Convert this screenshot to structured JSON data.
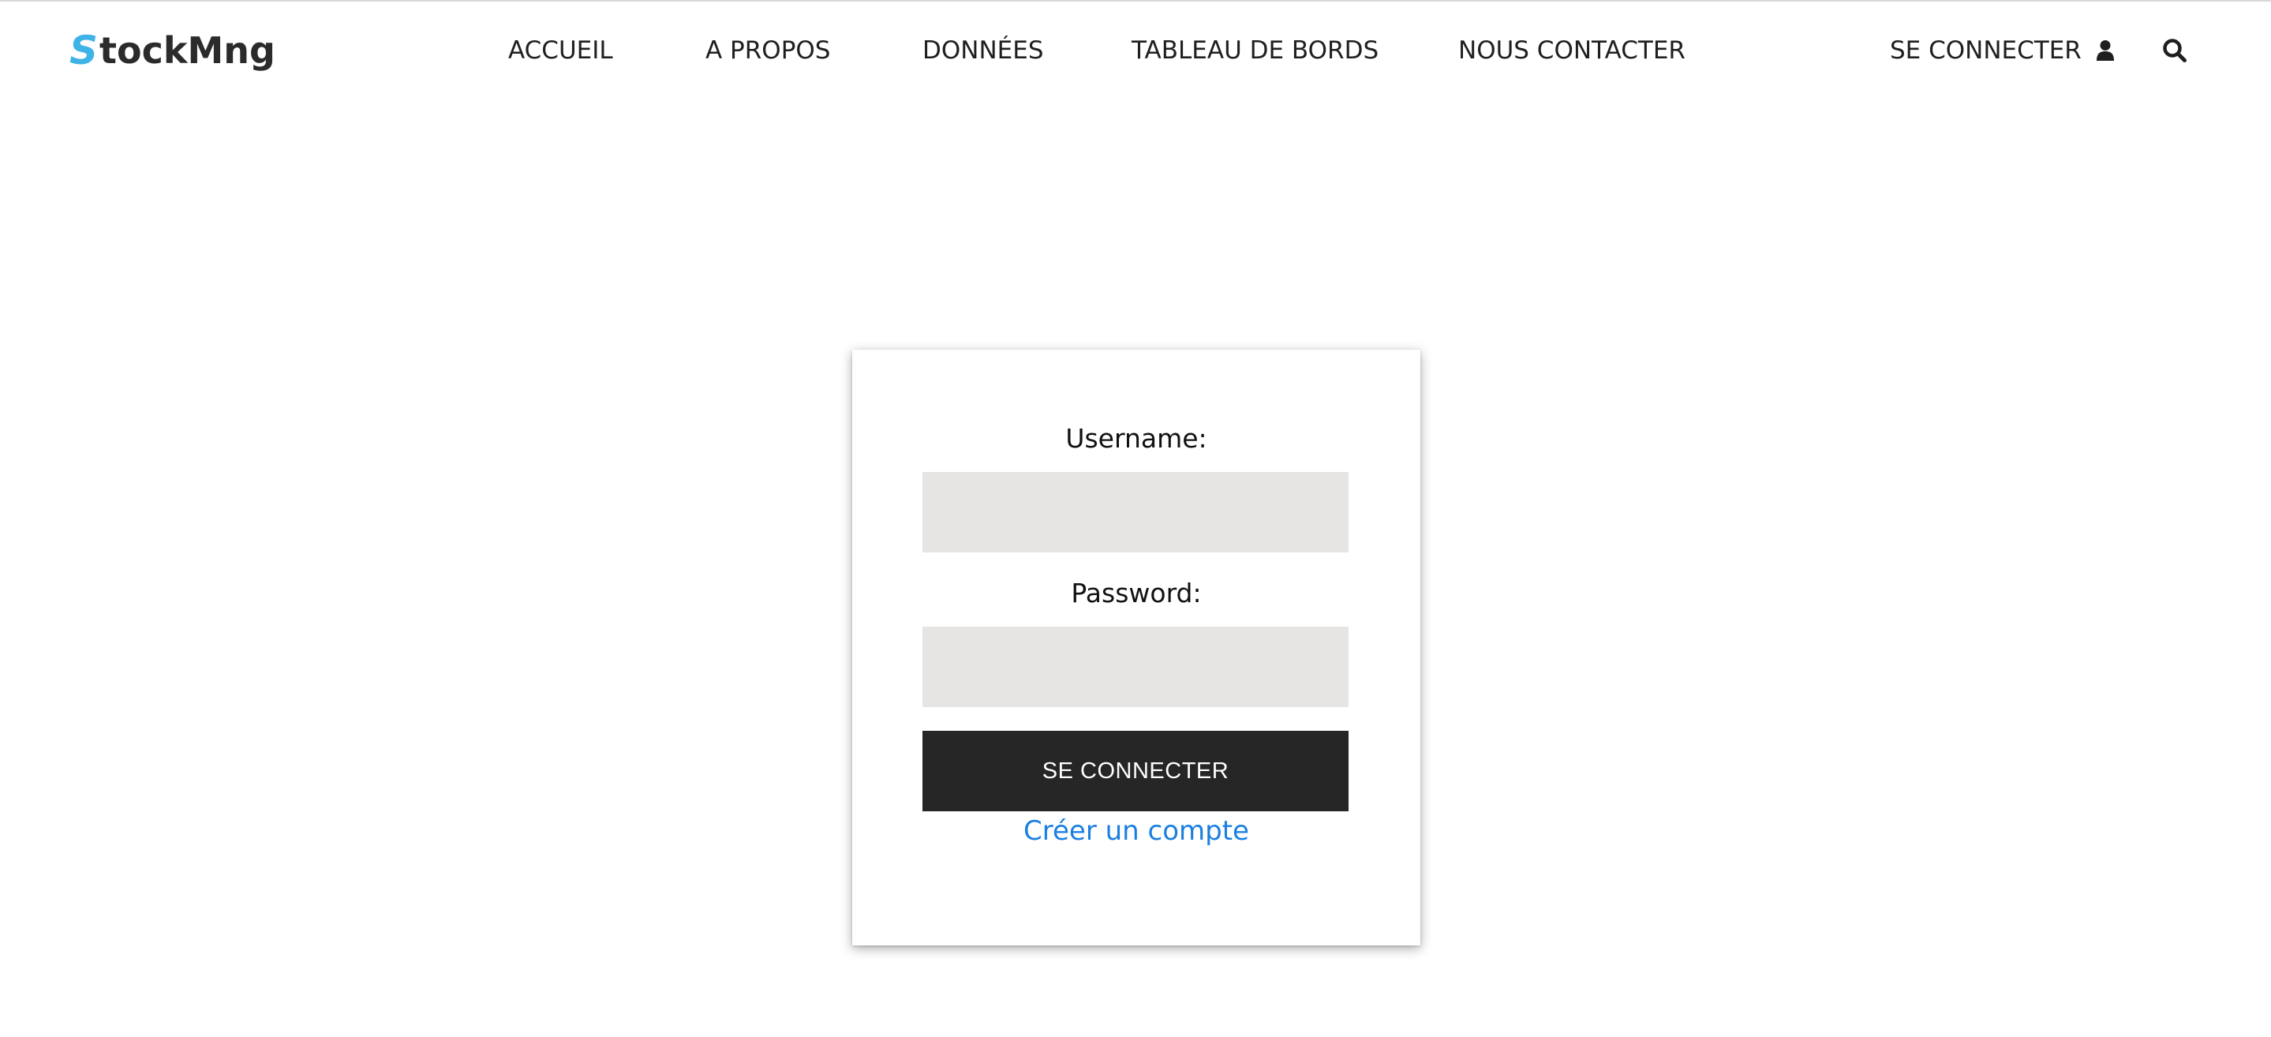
{
  "brand": {
    "logo_initial": "S",
    "logo_rest": "tockMng",
    "accent_color": "#3fb3e6"
  },
  "nav": {
    "items": [
      {
        "label": "ACCUEIL"
      },
      {
        "label": "A PROPOS"
      },
      {
        "label": "DONNÉES"
      },
      {
        "label": "TABLEAU DE BORDS"
      },
      {
        "label": "NOUS CONTACTER"
      }
    ],
    "login_label": "SE CONNECTER",
    "login_icon": "user-icon",
    "search_icon": "search-icon"
  },
  "login_form": {
    "username_label": "Username:",
    "username_value": "",
    "password_label": "Password:",
    "password_value": "",
    "submit_label": "SE CONNECTER",
    "create_account_label": "Créer un compte",
    "link_color": "#1a7fe0",
    "button_color": "#262626",
    "input_bg_color": "#e6e5e3"
  }
}
